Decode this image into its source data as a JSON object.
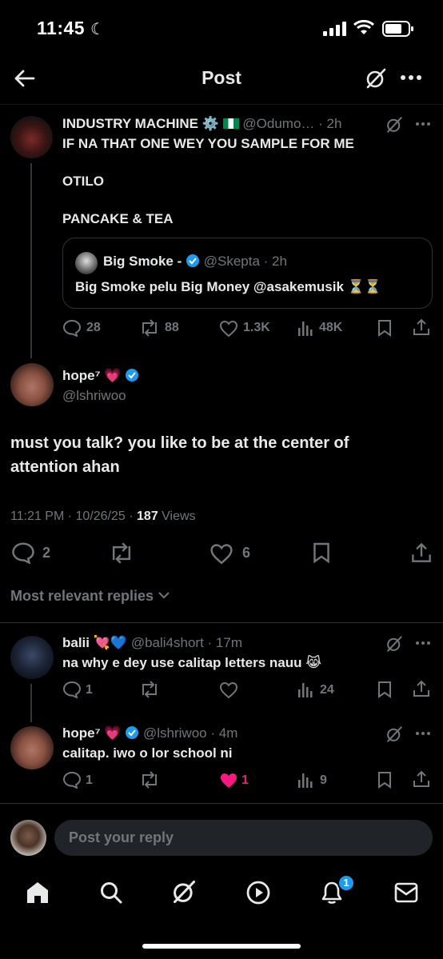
{
  "status": {
    "time": "11:45"
  },
  "header": {
    "title": "Post"
  },
  "parent_post": {
    "display_name": "INDUSTRY MACHINE",
    "handle": "@Odumo…",
    "time": "· 2h",
    "lines": [
      "IF NA THAT ONE WEY YOU SAMPLE FOR ME",
      "OTILO",
      "PANCAKE & TEA"
    ],
    "quote": {
      "display_name": "Big Smoke -",
      "handle": "@Skepta",
      "time": "· 2h",
      "text": "Big Smoke pelu Big Money @asakemusik ⏳⏳"
    },
    "replies": "28",
    "reposts": "88",
    "likes": "1.3K",
    "views": "48K"
  },
  "main_post": {
    "display_name": "hope⁷",
    "handle": "@lshriwoo",
    "text_line1": "must you talk? you like to be at the center of",
    "text_line2": "attention ahan",
    "meta_time": "11:21 PM · 10/26/25 · ",
    "views_count": "187",
    "views_label": " Views",
    "replies": "2",
    "likes": "6"
  },
  "sort": {
    "label": "Most relevant replies"
  },
  "replies": [
    {
      "display_name": "balii",
      "emoji": "💘💙",
      "handle": "@bali4short",
      "time": "· 17m",
      "text": "na why e dey use calitap letters nauu 😹",
      "replies": "1",
      "likes": "",
      "views": "24"
    },
    {
      "display_name": "hope⁷",
      "emoji": "💗",
      "handle": "@lshriwoo",
      "time": "· 4m",
      "text": "calitap. iwo o lor school ni",
      "replies": "1",
      "likes": "1",
      "views": "9"
    }
  ],
  "composer": {
    "placeholder": "Post your reply"
  },
  "nav": {
    "notification_badge": "1"
  },
  "colors": {
    "accent": "#1d9bf0",
    "like": "#f91880",
    "muted": "#71767b",
    "bg": "#000000"
  }
}
